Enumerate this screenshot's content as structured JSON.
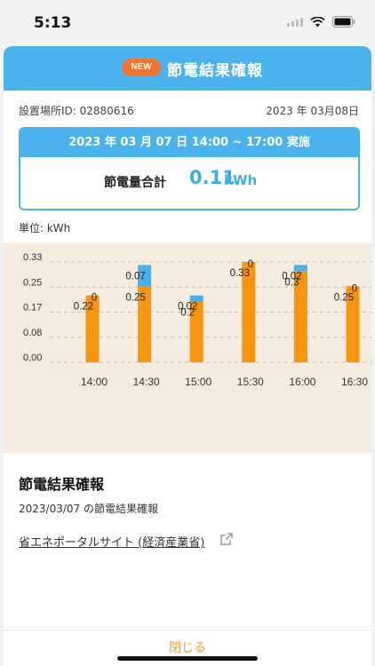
{
  "status_bar": {
    "time": "5:13"
  },
  "header": {
    "badge": "NEW",
    "title": "節電結果確報"
  },
  "info": {
    "location_id": "設置場所ID: 02880616",
    "report_date": "2023 年 03月08日"
  },
  "summary": {
    "period": "2023 年 03 月 07 日 14:00 ~ 17:00 実施",
    "label": "節電量合計",
    "value": "0.11",
    "unit": "kWh"
  },
  "unit_label": "単位: kWh",
  "chart_data": {
    "type": "bar",
    "stacked": true,
    "categories": [
      "14:00",
      "14:30",
      "15:00",
      "15:30",
      "16:00",
      "16:30"
    ],
    "series": [
      {
        "values": [
          0.22,
          0.25,
          0.2,
          0.33,
          0.3,
          0.25
        ],
        "labels": [
          "0.22",
          "0.25",
          "0.2",
          "0.33",
          "0.3",
          "0.25"
        ],
        "color": "#f6960f"
      },
      {
        "values": [
          0,
          0.07,
          0.02,
          0,
          0.02,
          0
        ],
        "labels": [
          "0",
          "0.07",
          "0.02",
          "0",
          "0.02",
          "0"
        ],
        "color": "#45b1ee"
      }
    ],
    "y_ticks": [
      "0.00",
      "0.08",
      "0.17",
      "0.25",
      "0.33"
    ],
    "ylim": [
      0,
      0.33
    ],
    "grid": true,
    "legend": "none"
  },
  "section": {
    "title": "節電結果確報",
    "subtitle": "2023/03/07 の節電結果確報",
    "link": "省エネポータルサイト (経済産業省)"
  },
  "footer": {
    "close_label": "閉じる"
  },
  "colors": {
    "header": "#4ab3ed",
    "badge": "#f2722e",
    "accent": "#f29a2e",
    "chart_bg": "#f6ebdf"
  }
}
